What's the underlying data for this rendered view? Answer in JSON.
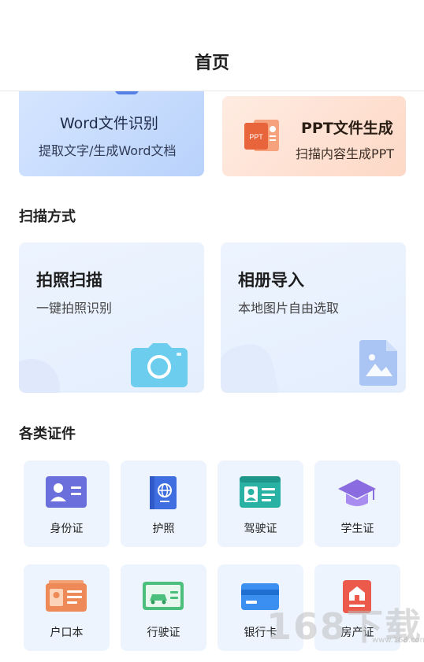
{
  "header": {
    "title": "首页"
  },
  "top_cards": [
    {
      "title": "Word文件识别",
      "subtitle": "提取文字/生成Word文档"
    },
    {
      "title": "PPT文件生成",
      "subtitle": "扫描内容生成PPT",
      "icon_label": "PPT"
    }
  ],
  "scan_section": {
    "title": "扫描方式"
  },
  "scan_cards": [
    {
      "title": "拍照扫描",
      "subtitle": "一键拍照识别",
      "icon": "camera-icon"
    },
    {
      "title": "相册导入",
      "subtitle": "本地图片自由选取",
      "icon": "image-file-icon"
    }
  ],
  "id_section": {
    "title": "各类证件"
  },
  "id_types": [
    {
      "label": "身份证",
      "icon": "id-card-icon"
    },
    {
      "label": "护照",
      "icon": "passport-icon"
    },
    {
      "label": "驾驶证",
      "icon": "driver-license-icon"
    },
    {
      "label": "学生证",
      "icon": "graduation-cap-icon"
    },
    {
      "label": "户口本",
      "icon": "household-register-icon"
    },
    {
      "label": "行驶证",
      "icon": "vehicle-license-icon"
    },
    {
      "label": "银行卡",
      "icon": "bank-card-icon"
    },
    {
      "label": "房产证",
      "icon": "property-certificate-icon"
    }
  ],
  "watermark": {
    "text": "168下载",
    "sub": "www.168.com"
  },
  "colors": {
    "accent_blue": "#3f6ee0",
    "ppt_orange": "#e8643a",
    "tile_bg": "#eef4fd"
  }
}
